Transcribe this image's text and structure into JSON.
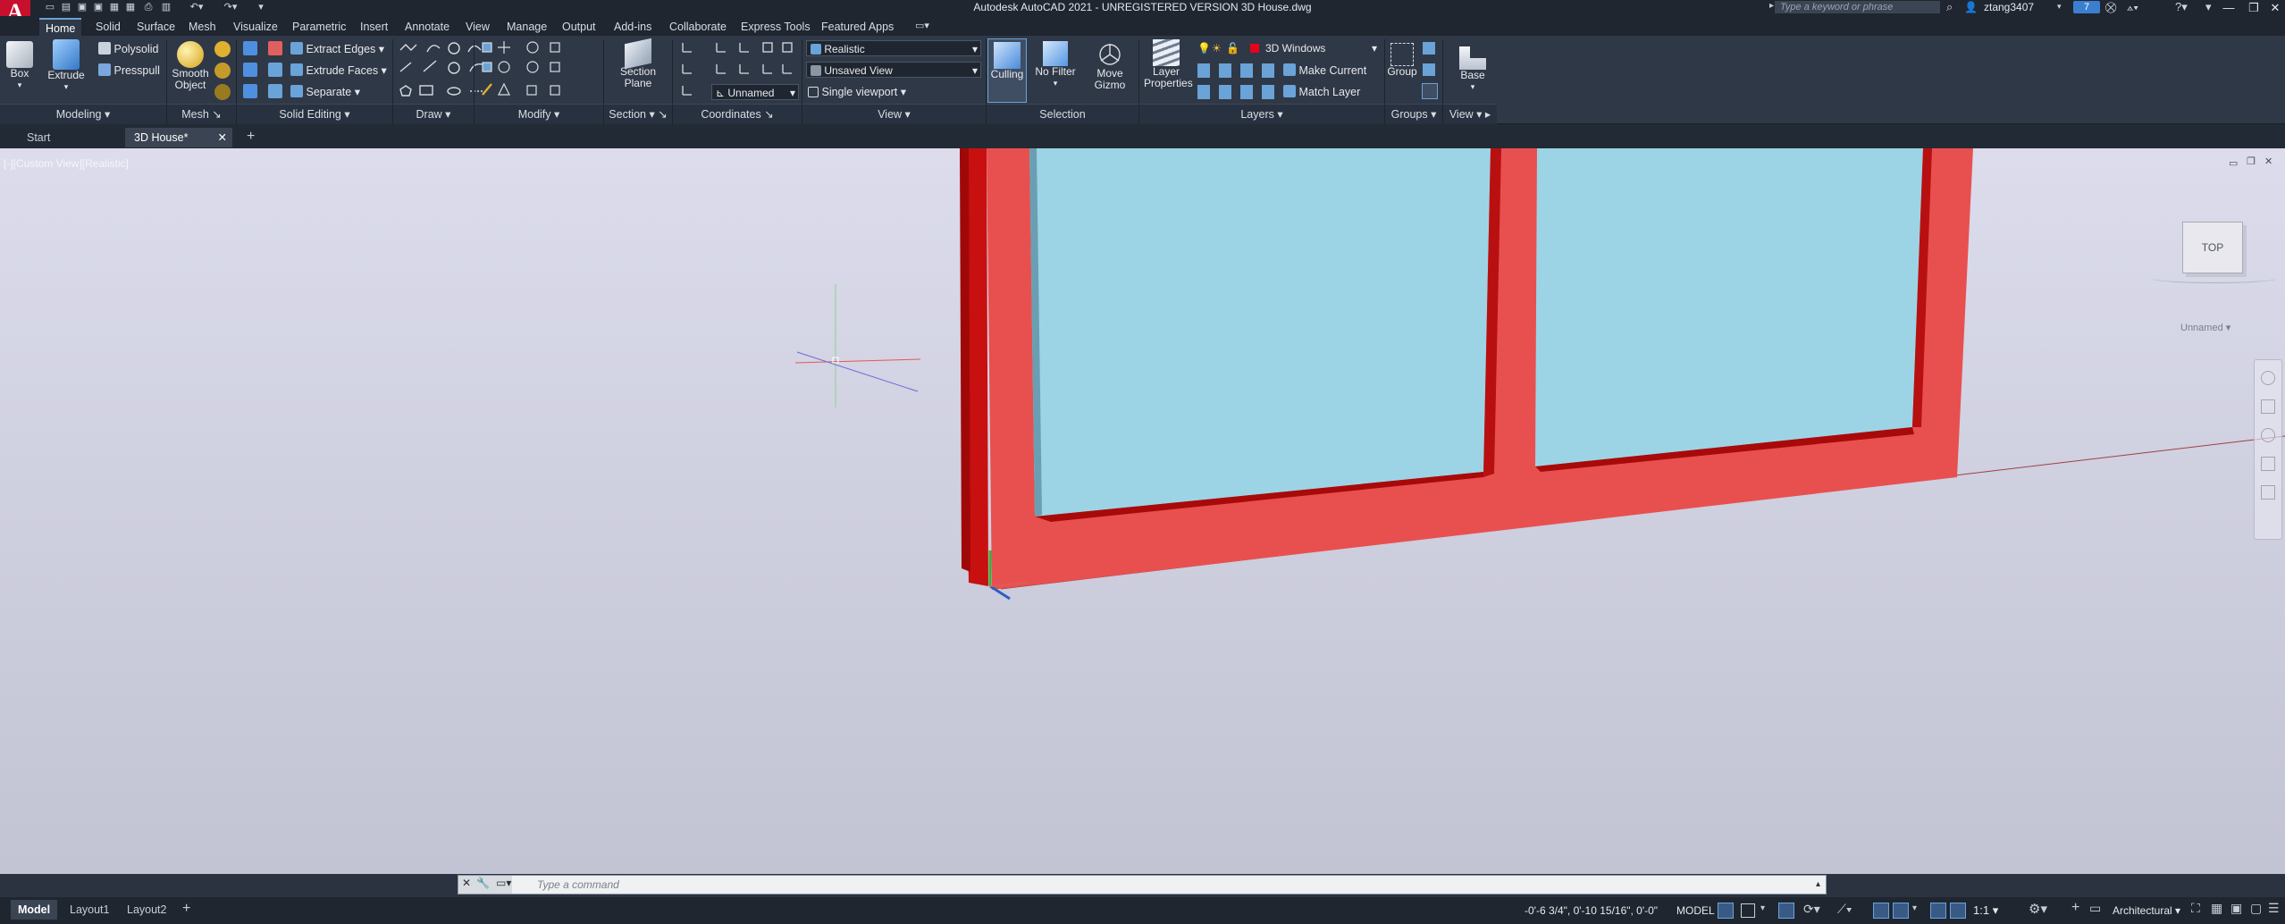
{
  "app": {
    "title": "Autodesk AutoCAD 2021 - UNREGISTERED VERSION    3D House.dwg",
    "logo_letter": "A",
    "search_placeholder": "Type a keyword or phrase",
    "user": "ztang3407",
    "notification_count": "7"
  },
  "ribbon_tabs": [
    "Home",
    "Solid",
    "Surface",
    "Mesh",
    "Visualize",
    "Parametric",
    "Insert",
    "Annotate",
    "View",
    "Manage",
    "Output",
    "Add-ins",
    "Collaborate",
    "Express Tools",
    "Featured Apps"
  ],
  "active_ribbon_tab": "Home",
  "ribbon": {
    "modeling": {
      "box": "Box",
      "extrude": "Extrude",
      "polysolid": "Polysolid",
      "presspull": "Presspull",
      "panel": "Modeling"
    },
    "mesh": {
      "smooth_object": "Smooth Object",
      "panel": "Mesh"
    },
    "solid_editing": {
      "extract_edges": "Extract Edges",
      "extrude_faces": "Extrude Faces",
      "separate": "Separate",
      "panel": "Solid Editing"
    },
    "draw": {
      "panel": "Draw"
    },
    "modify": {
      "panel": "Modify"
    },
    "section": {
      "section_plane": "Section Plane",
      "panel": "Section"
    },
    "coordinates": {
      "ucs_name": "Unnamed",
      "panel": "Coordinates"
    },
    "view": {
      "visual_style": "Realistic",
      "named_view": "Unsaved View",
      "viewport": "Single viewport",
      "panel": "View"
    },
    "selection": {
      "culling": "Culling",
      "no_filter": "No Filter",
      "move_gizmo": "Move Gizmo",
      "panel": "Selection"
    },
    "layers": {
      "layer_properties": "Layer Properties",
      "current_layer": "3D Windows",
      "make_current": "Make Current",
      "match_layer": "Match Layer",
      "panel": "Layers",
      "layer_color": "#e8001c"
    },
    "groups": {
      "group": "Group",
      "panel": "Groups"
    },
    "view2": {
      "base": "Base",
      "panel": "View"
    }
  },
  "doc_tabs": [
    "Start",
    "3D House*"
  ],
  "active_doc_tab": "3D House*",
  "viewport": {
    "label": "[-][Custom View][Realistic]",
    "viewcube_face": "TOP",
    "ucs_label": "Unnamed"
  },
  "command_line": {
    "placeholder": "Type  a  command"
  },
  "layout_tabs": [
    "Model",
    "Layout1",
    "Layout2"
  ],
  "active_layout_tab": "Model",
  "status": {
    "coordinates": "-0'-6 3/4\", 0'-10 15/16\", 0'-0\"",
    "space": "MODEL",
    "scale": "1:1",
    "units": "Architectural"
  },
  "colors": {
    "frame_red": "#e85050",
    "frame_dark_red": "#c81010",
    "glass_blue": "#9cd4e6",
    "accent_blue": "#6aa3d8"
  }
}
